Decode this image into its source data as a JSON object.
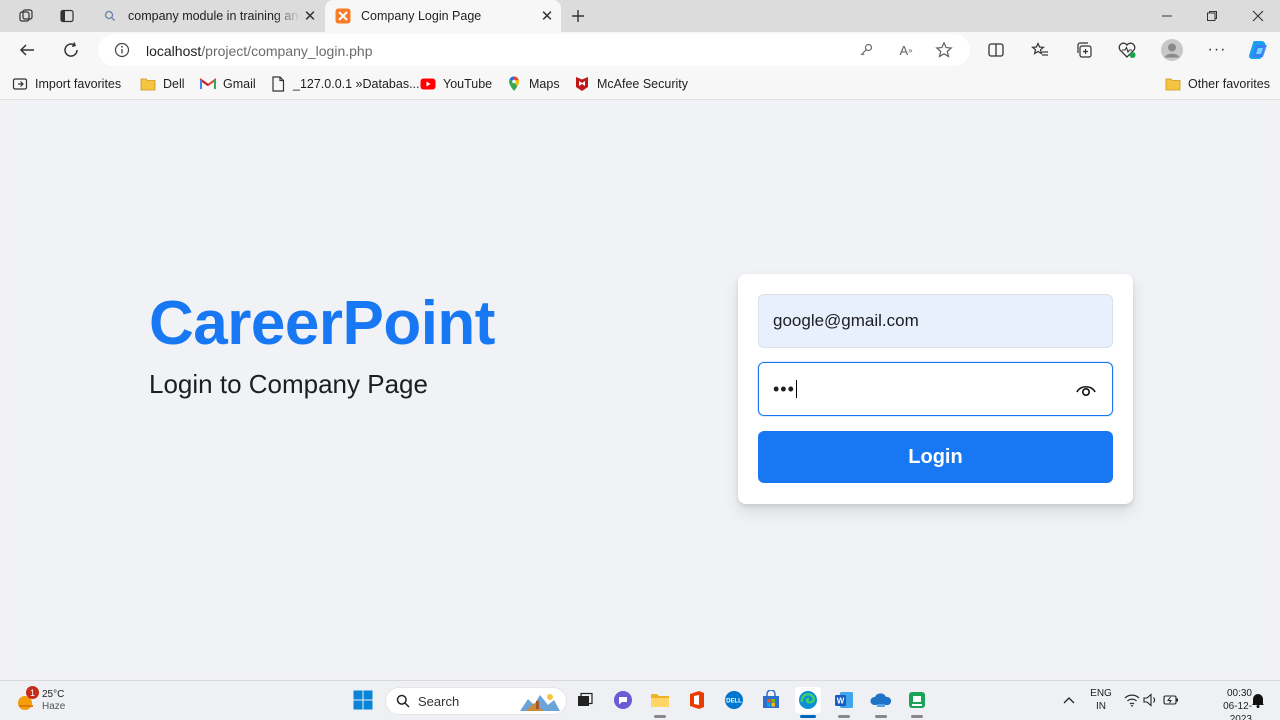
{
  "browser": {
    "tabs": [
      {
        "title": "company module in training and",
        "favicon": "search-icon",
        "active": false
      },
      {
        "title": "Company Login Page",
        "favicon": "xampp-icon",
        "active": true
      }
    ],
    "url": {
      "host": "localhost",
      "path": "/project/company_login.php"
    },
    "favorites": [
      {
        "label": "Import favorites",
        "icon": "import-icon"
      },
      {
        "label": "Dell",
        "icon": "folder-icon"
      },
      {
        "label": "Gmail",
        "icon": "gmail-icon"
      },
      {
        "label": "_127.0.0.1 »Databas...",
        "icon": "page-icon"
      },
      {
        "label": "YouTube",
        "icon": "youtube-icon"
      },
      {
        "label": "Maps",
        "icon": "maps-icon"
      },
      {
        "label": "McAfee Security",
        "icon": "mcafee-icon"
      }
    ],
    "other_favorites": "Other favorites"
  },
  "page": {
    "brand": "CareerPoint",
    "tagline": "Login to Company Page",
    "email_value": "google@gmail.com",
    "password_mask": "•••",
    "login_label": "Login",
    "colors": {
      "brand": "#1877f2",
      "background": "#f0f2f5",
      "email_autofill": "#e8f0fe"
    }
  },
  "taskbar": {
    "weather": {
      "temp": "25°C",
      "condition": "Haze",
      "badge": "1"
    },
    "search_label": "Search",
    "language": {
      "line1": "ENG",
      "line2": "IN"
    },
    "time": "00:30",
    "date": "06-12-2023"
  }
}
